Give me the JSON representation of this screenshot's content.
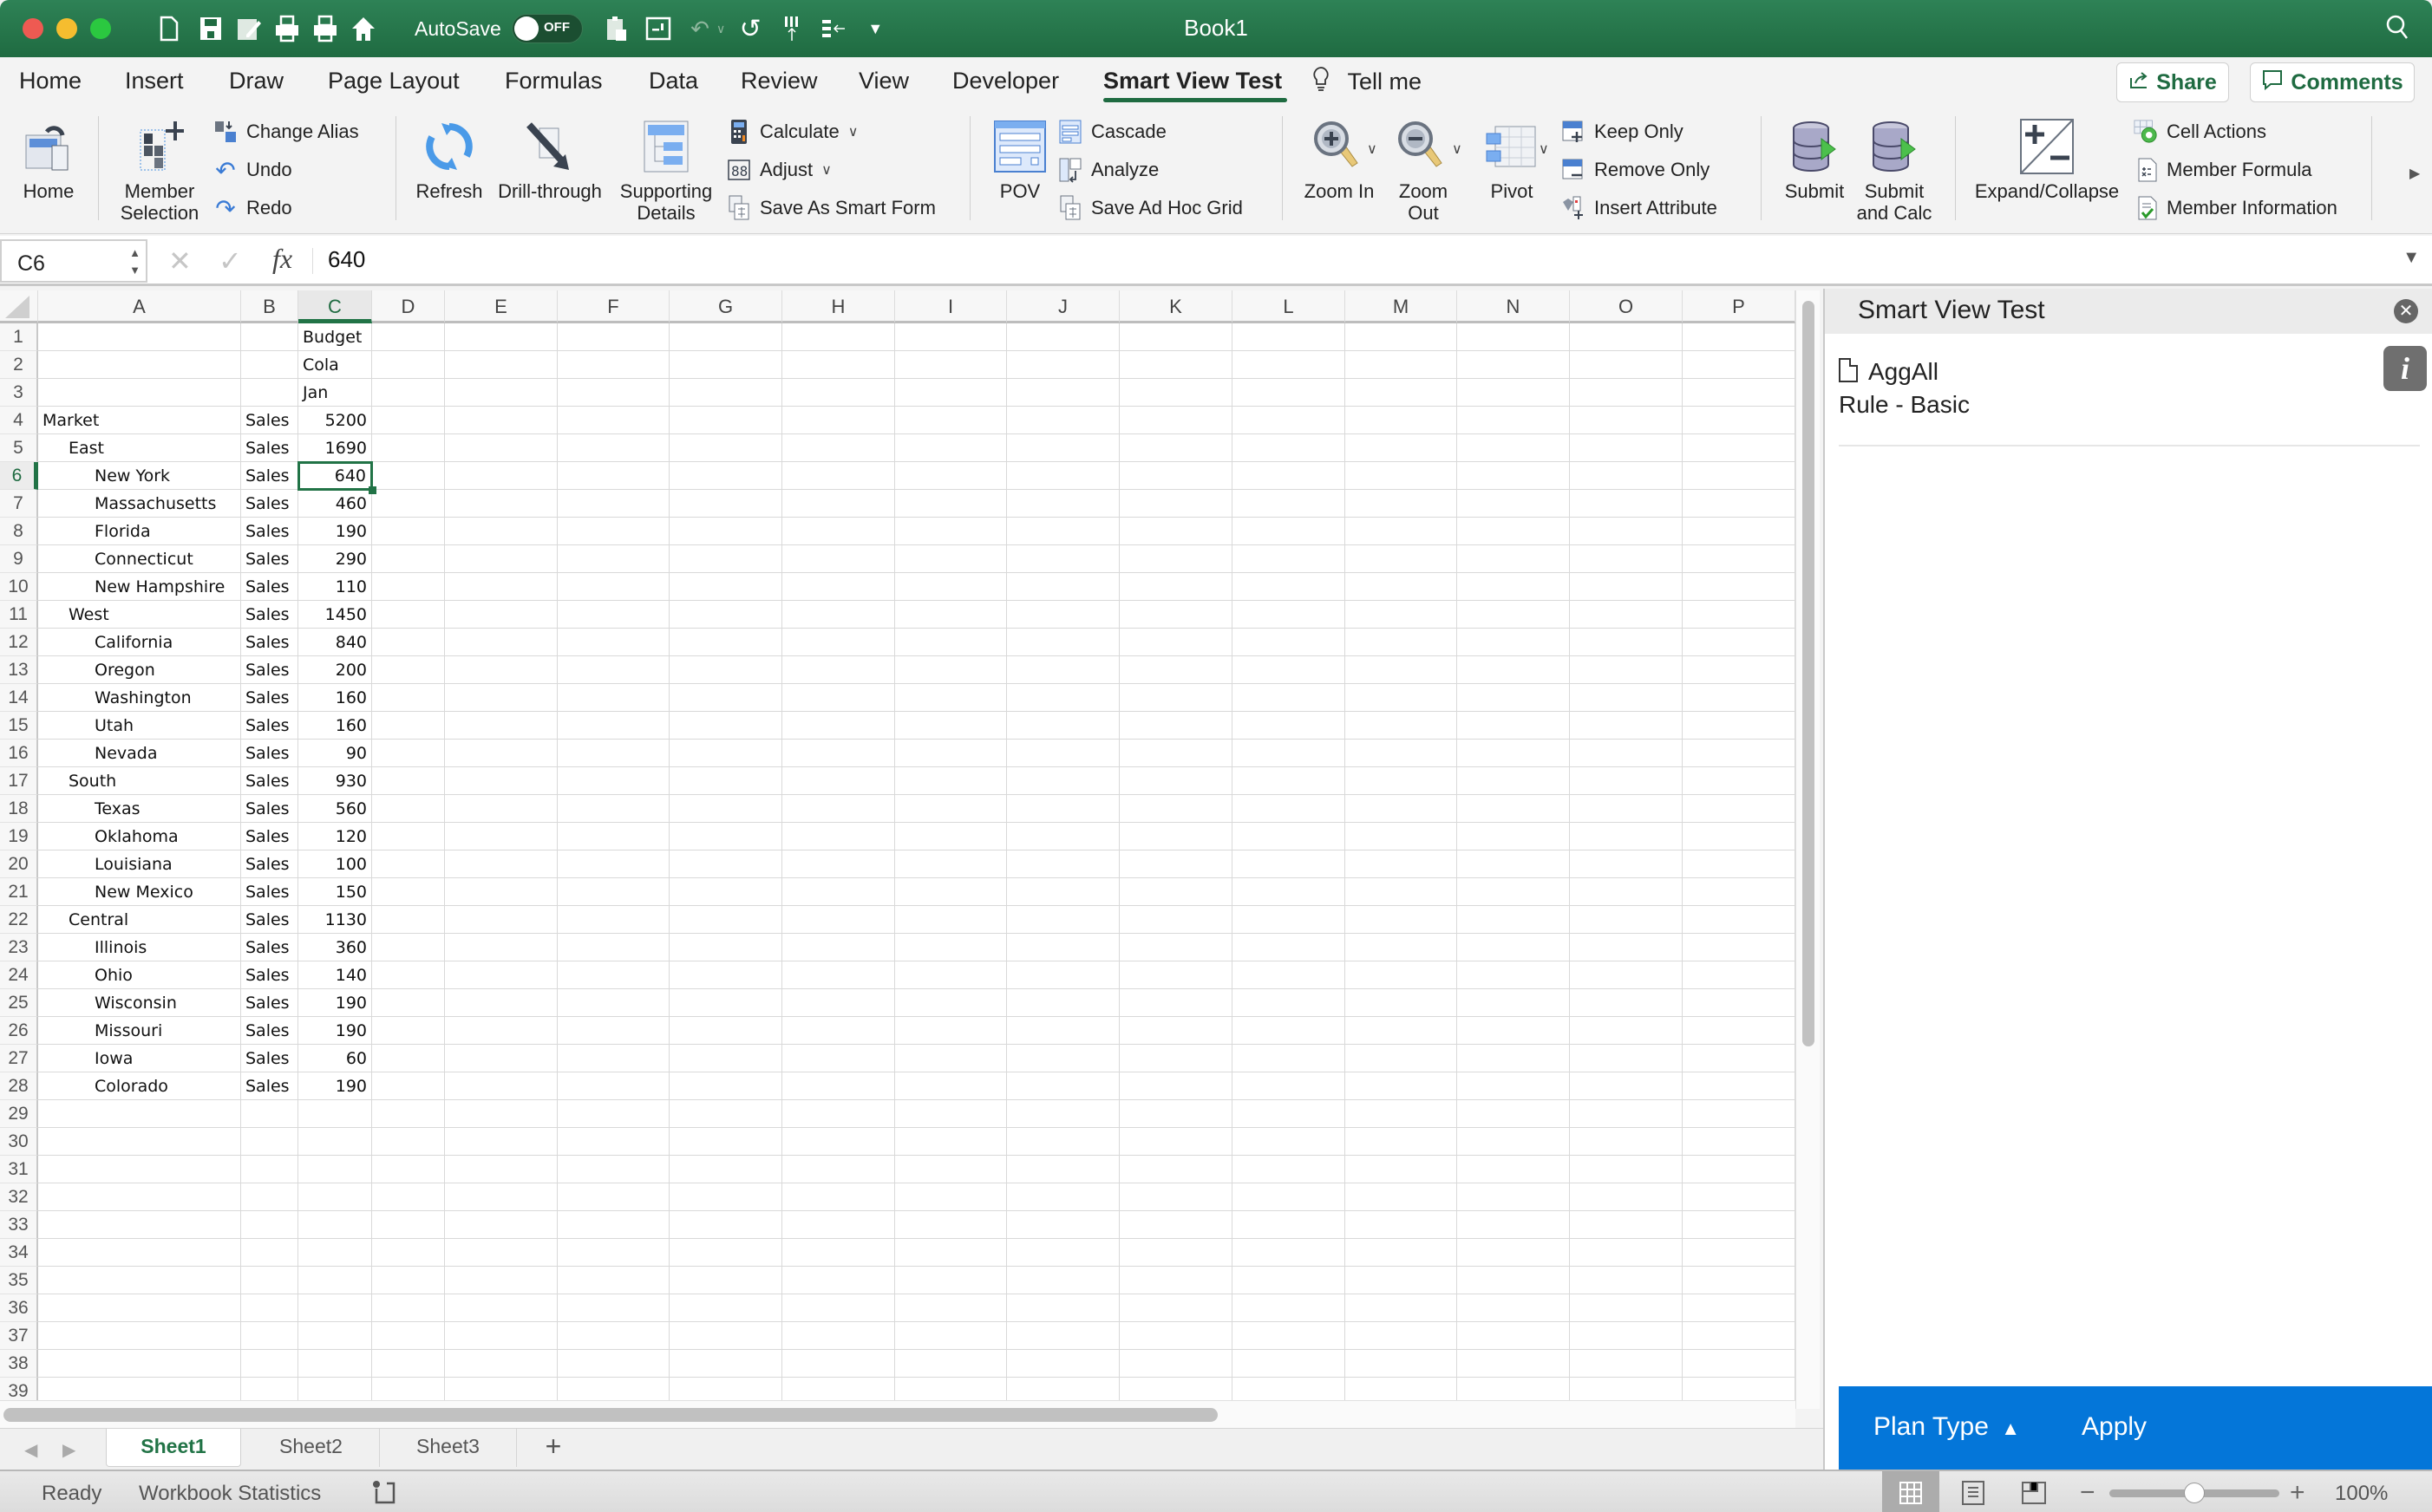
{
  "titlebar": {
    "title": "Book1",
    "autosave_label": "AutoSave",
    "autosave_state": "OFF"
  },
  "ribbon_tabs": [
    {
      "label": "Home"
    },
    {
      "label": "Insert"
    },
    {
      "label": "Draw"
    },
    {
      "label": "Page Layout"
    },
    {
      "label": "Formulas"
    },
    {
      "label": "Data"
    },
    {
      "label": "Review"
    },
    {
      "label": "View"
    },
    {
      "label": "Developer"
    },
    {
      "label": "Smart View Test",
      "active": true
    }
  ],
  "tell_me": "Tell me",
  "share_label": "Share",
  "comments_label": "Comments",
  "ribbon": {
    "home": "Home",
    "member_selection": [
      "Member",
      "Selection"
    ],
    "change_alias": "Change Alias",
    "undo": "Undo",
    "redo": "Redo",
    "refresh": "Refresh",
    "drill_through": "Drill-through",
    "supporting_details": [
      "Supporting",
      "Details"
    ],
    "calculate": "Calculate",
    "adjust": "Adjust",
    "save_as_smart_form": "Save As Smart Form",
    "pov": "POV",
    "cascade": "Cascade",
    "analyze": "Analyze",
    "save_ad_hoc_grid": "Save Ad Hoc Grid",
    "zoom_in": "Zoom In",
    "zoom_out": [
      "Zoom",
      "Out"
    ],
    "pivot": "Pivot",
    "keep_only": "Keep Only",
    "remove_only": "Remove Only",
    "insert_attribute": "Insert Attribute",
    "submit": "Submit",
    "submit_and_calc": [
      "Submit",
      "and Calc"
    ],
    "expand_collapse": "Expand/Collapse",
    "cell_actions": "Cell Actions",
    "member_formula": "Member Formula",
    "member_information": "Member Information"
  },
  "formula_bar": {
    "name_box": "C6",
    "fx": "fx",
    "value": "640"
  },
  "columns": [
    "A",
    "B",
    "C",
    "D",
    "E",
    "F",
    "G",
    "H",
    "I",
    "J",
    "K",
    "L",
    "M",
    "N",
    "O",
    "P"
  ],
  "selected_column": "C",
  "selected_row": 6,
  "row_count": 39,
  "rows": [
    {
      "r": 1,
      "a": "",
      "b": "",
      "c": "Budget",
      "indent": 0,
      "c_num": false
    },
    {
      "r": 2,
      "a": "",
      "b": "",
      "c": "Cola",
      "indent": 0,
      "c_num": false
    },
    {
      "r": 3,
      "a": "",
      "b": "",
      "c": "Jan",
      "indent": 0,
      "c_num": false
    },
    {
      "r": 4,
      "a": "Market",
      "b": "Sales",
      "c": "5200",
      "indent": 0,
      "c_num": true
    },
    {
      "r": 5,
      "a": "East",
      "b": "Sales",
      "c": "1690",
      "indent": 1,
      "c_num": true
    },
    {
      "r": 6,
      "a": "New York",
      "b": "Sales",
      "c": "640",
      "indent": 2,
      "c_num": true
    },
    {
      "r": 7,
      "a": "Massachusetts",
      "b": "Sales",
      "c": "460",
      "indent": 2,
      "c_num": true
    },
    {
      "r": 8,
      "a": "Florida",
      "b": "Sales",
      "c": "190",
      "indent": 2,
      "c_num": true
    },
    {
      "r": 9,
      "a": "Connecticut",
      "b": "Sales",
      "c": "290",
      "indent": 2,
      "c_num": true
    },
    {
      "r": 10,
      "a": "New Hampshire",
      "b": "Sales",
      "c": "110",
      "indent": 2,
      "c_num": true
    },
    {
      "r": 11,
      "a": "West",
      "b": "Sales",
      "c": "1450",
      "indent": 1,
      "c_num": true
    },
    {
      "r": 12,
      "a": "California",
      "b": "Sales",
      "c": "840",
      "indent": 2,
      "c_num": true
    },
    {
      "r": 13,
      "a": "Oregon",
      "b": "Sales",
      "c": "200",
      "indent": 2,
      "c_num": true
    },
    {
      "r": 14,
      "a": "Washington",
      "b": "Sales",
      "c": "160",
      "indent": 2,
      "c_num": true
    },
    {
      "r": 15,
      "a": "Utah",
      "b": "Sales",
      "c": "160",
      "indent": 2,
      "c_num": true
    },
    {
      "r": 16,
      "a": "Nevada",
      "b": "Sales",
      "c": "90",
      "indent": 2,
      "c_num": true
    },
    {
      "r": 17,
      "a": "South",
      "b": "Sales",
      "c": "930",
      "indent": 1,
      "c_num": true
    },
    {
      "r": 18,
      "a": "Texas",
      "b": "Sales",
      "c": "560",
      "indent": 2,
      "c_num": true
    },
    {
      "r": 19,
      "a": "Oklahoma",
      "b": "Sales",
      "c": "120",
      "indent": 2,
      "c_num": true
    },
    {
      "r": 20,
      "a": "Louisiana",
      "b": "Sales",
      "c": "100",
      "indent": 2,
      "c_num": true
    },
    {
      "r": 21,
      "a": "New Mexico",
      "b": "Sales",
      "c": "150",
      "indent": 2,
      "c_num": true
    },
    {
      "r": 22,
      "a": "Central",
      "b": "Sales",
      "c": "1130",
      "indent": 1,
      "c_num": true
    },
    {
      "r": 23,
      "a": "Illinois",
      "b": "Sales",
      "c": "360",
      "indent": 2,
      "c_num": true
    },
    {
      "r": 24,
      "a": "Ohio",
      "b": "Sales",
      "c": "140",
      "indent": 2,
      "c_num": true
    },
    {
      "r": 25,
      "a": "Wisconsin",
      "b": "Sales",
      "c": "190",
      "indent": 2,
      "c_num": true
    },
    {
      "r": 26,
      "a": "Missouri",
      "b": "Sales",
      "c": "190",
      "indent": 2,
      "c_num": true
    },
    {
      "r": 27,
      "a": "Iowa",
      "b": "Sales",
      "c": "60",
      "indent": 2,
      "c_num": true
    },
    {
      "r": 28,
      "a": "Colorado",
      "b": "Sales",
      "c": "190",
      "indent": 2,
      "c_num": true
    }
  ],
  "sheets": [
    {
      "label": "Sheet1",
      "active": true
    },
    {
      "label": "Sheet2"
    },
    {
      "label": "Sheet3"
    }
  ],
  "status": {
    "ready": "Ready",
    "workbook_statistics": "Workbook Statistics",
    "zoom_percent": "100%",
    "zoom_level": 1.0
  },
  "panel": {
    "title": "Smart View Test",
    "rule_name": "AggAll",
    "rule_type": "Rule - Basic",
    "info_label": "i",
    "plan_type_label": "Plan Type",
    "apply_label": "Apply"
  },
  "colors": {
    "excel_green": "#217346",
    "panel_blue": "#0476d9"
  }
}
